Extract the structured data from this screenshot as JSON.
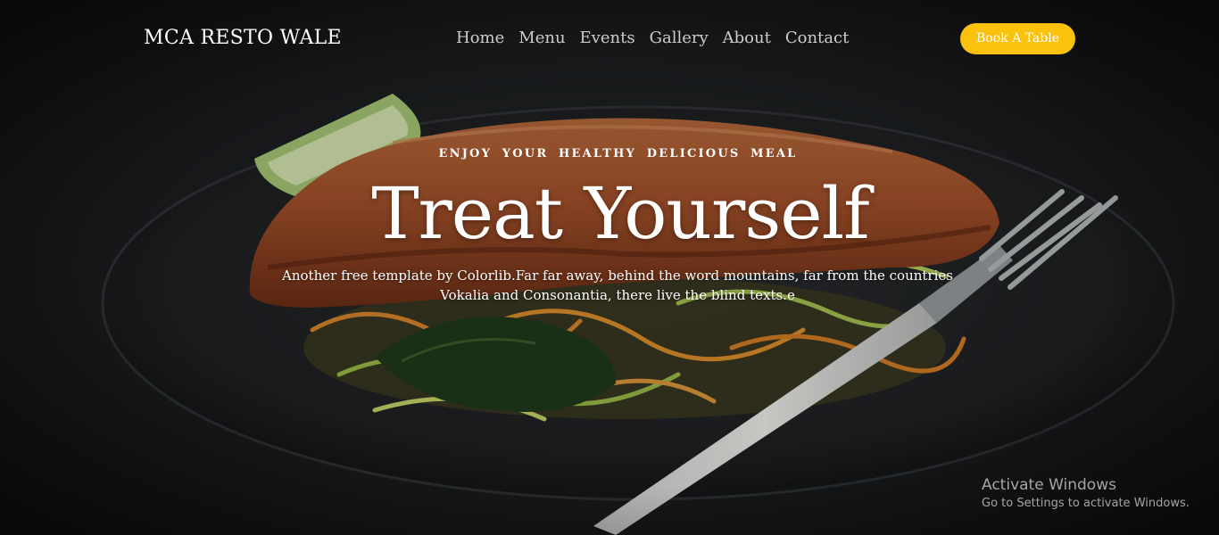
{
  "brand": {
    "name": "MCA RESTO WALE"
  },
  "nav": {
    "items": [
      {
        "label": "Home"
      },
      {
        "label": "Menu"
      },
      {
        "label": "Events"
      },
      {
        "label": "Gallery"
      },
      {
        "label": "About"
      },
      {
        "label": "Contact"
      }
    ],
    "cta_label": "Book A Table"
  },
  "hero": {
    "tagline": "ENJOY YOUR HEALTHY DELICIOUS MEAL",
    "headline": "Treat Yourself",
    "subtitle": "Another free template by Colorlib.Far far away, behind the word mountains, far from the countries Vokalia and Consonantia, there live the blind texts.e"
  },
  "watermark": {
    "title": "Activate Windows",
    "subtitle": "Go to Settings to activate Windows."
  },
  "colors": {
    "accent": "#fac20c",
    "background": "#1b1d1f",
    "text": "#ffffff"
  }
}
